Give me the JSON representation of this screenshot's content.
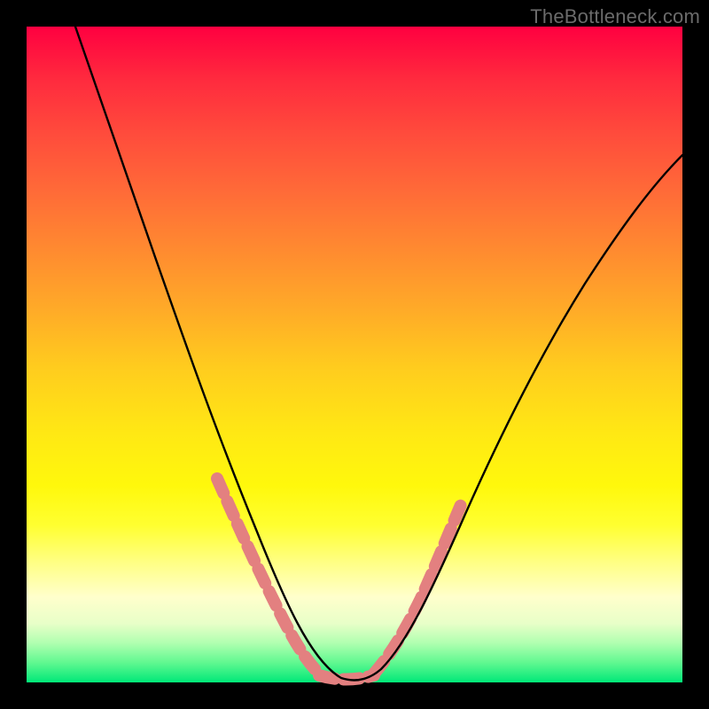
{
  "watermark": "TheBottleneck.com",
  "colors": {
    "frame": "#000000",
    "curve": "#000000",
    "highlight": "#e38080",
    "gradient_top": "#ff0040",
    "gradient_bottom": "#00e878"
  },
  "chart_data": {
    "type": "line",
    "title": "",
    "xlabel": "",
    "ylabel": "",
    "xlim": [
      0,
      100
    ],
    "ylim": [
      0,
      100
    ],
    "grid": false,
    "legend": false,
    "note": "Values are estimated from pixel positions; chart has no axis ticks or labels.",
    "series": [
      {
        "name": "bottleneck-curve",
        "x": [
          0,
          3,
          6,
          9,
          12,
          15,
          18,
          21,
          24,
          27,
          30,
          33,
          36,
          39,
          42,
          45,
          48,
          51,
          54,
          57,
          60,
          63,
          66,
          69,
          72,
          75,
          78,
          81,
          84,
          87,
          90,
          93,
          96,
          100
        ],
        "y": [
          100,
          93,
          86,
          79,
          72,
          65,
          58,
          51,
          44,
          37,
          30,
          23,
          17,
          11,
          6,
          2,
          0,
          0,
          2,
          6,
          11,
          17,
          23,
          29,
          35,
          41,
          46,
          51,
          56,
          60,
          64,
          67,
          70,
          73
        ]
      },
      {
        "name": "near-min-left-markers",
        "x": [
          29,
          31,
          33,
          35,
          37,
          39,
          41,
          43
        ],
        "y": [
          31,
          25,
          20,
          15,
          11,
          7,
          4,
          2
        ]
      },
      {
        "name": "near-min-right-markers",
        "x": [
          52,
          54,
          56,
          58,
          60,
          62,
          64,
          66
        ],
        "y": [
          2,
          4,
          7,
          11,
          15,
          20,
          25,
          31
        ]
      },
      {
        "name": "flat-min-markers",
        "x": [
          45,
          47,
          49,
          51
        ],
        "y": [
          0,
          0,
          0,
          0
        ]
      }
    ]
  }
}
